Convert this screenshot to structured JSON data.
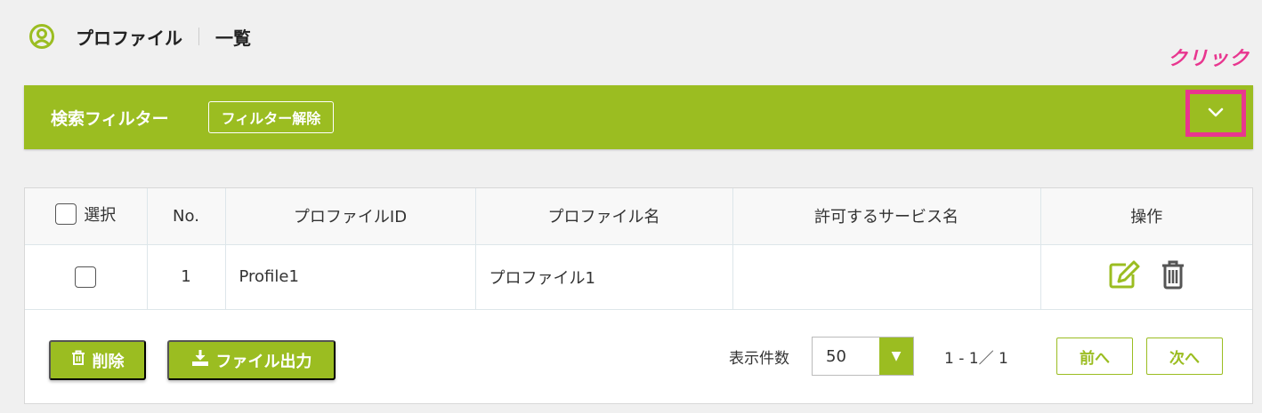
{
  "header": {
    "title": "プロファイル",
    "subtitle": "一覧",
    "icon": "user-circle-icon"
  },
  "annotation": {
    "click_label": "クリック"
  },
  "filter": {
    "title": "検索フィルター",
    "clear_label": "フィルター解除",
    "toggle_icon": "chevron-down-icon"
  },
  "table": {
    "headers": {
      "select": "選択",
      "no": "No.",
      "profile_id": "プロファイルID",
      "profile_name": "プロファイル名",
      "service_name": "許可するサービス名",
      "operation": "操作"
    },
    "rows": [
      {
        "no": "1",
        "profile_id": "Profile1",
        "profile_name": "プロファイル1",
        "service_name": "",
        "checked": false
      }
    ]
  },
  "footer": {
    "delete_label": "削除",
    "export_label": "ファイル出力",
    "per_page_label": "表示件数",
    "per_page_value": "50",
    "range_text": "1 - 1／ 1",
    "prev_label": "前へ",
    "next_label": "次へ"
  },
  "colors": {
    "accent": "#9bbd21",
    "highlight": "#e8368f"
  }
}
